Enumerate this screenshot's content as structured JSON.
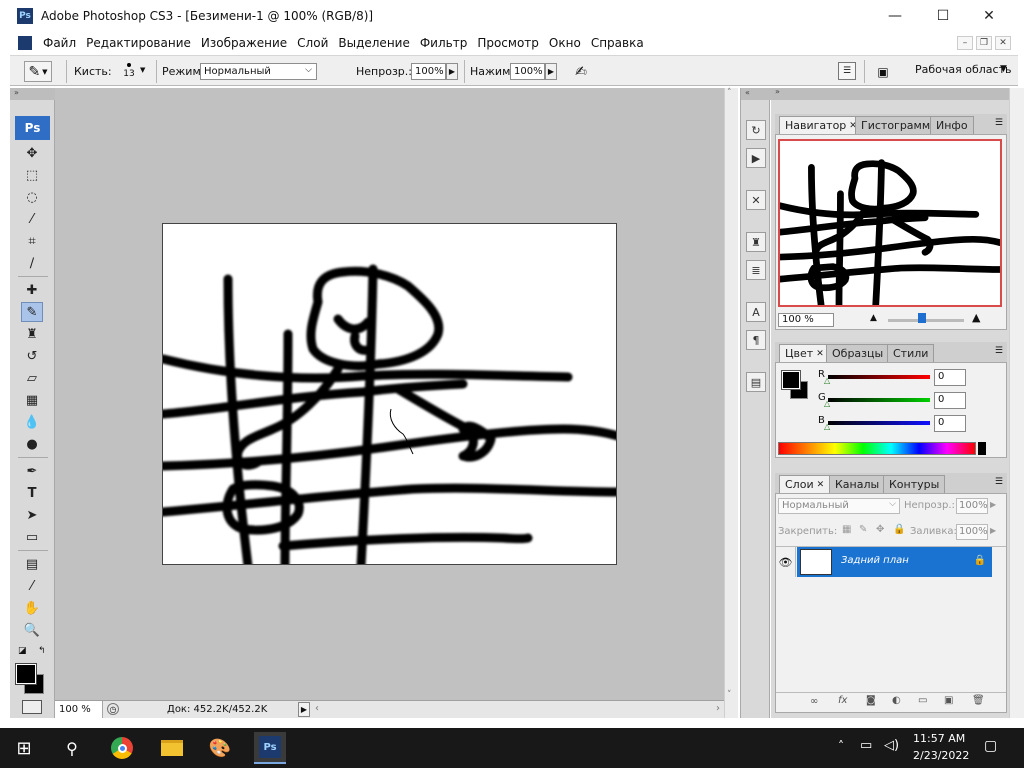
{
  "window": {
    "app_icon": "Ps",
    "title": "Adobe Photoshop CS3 - [Безимени-1 @ 100% (RGB/8)]",
    "minimize": "—",
    "maximize": "☐",
    "close": "✕"
  },
  "menu": [
    "Файл",
    "Редактирование",
    "Изображение",
    "Слой",
    "Выделение",
    "Фильтр",
    "Просмотр",
    "Окно",
    "Справка"
  ],
  "options": {
    "brush_label": "Кисть:",
    "brush_size": "13",
    "mode_label": "Режим:",
    "mode_value": "Нормальный",
    "opacity_label": "Непрозр.:",
    "opacity_value": "100%",
    "flow_label": "Нажим:",
    "flow_value": "100%",
    "workspace_label": "Рабочая область"
  },
  "toolbar": {
    "logo": "Ps"
  },
  "status": {
    "zoom": "100 %",
    "doc_info": "Док: 452.2K/452.2K"
  },
  "navigator": {
    "tabs": [
      "Навигатор",
      "Гистограмма",
      "Инфо"
    ],
    "zoom": "100 %"
  },
  "color_panel": {
    "tabs": [
      "Цвет",
      "Образцы",
      "Стили"
    ],
    "channels": [
      {
        "label": "R",
        "value": "0"
      },
      {
        "label": "G",
        "value": "0"
      },
      {
        "label": "B",
        "value": "0"
      }
    ]
  },
  "layers_panel": {
    "tabs": [
      "Слои",
      "Каналы",
      "Контуры"
    ],
    "blend_mode": "Нормальный",
    "opacity_label": "Непрозр.:",
    "opacity_value": "100%",
    "lock_label": "Закрепить:",
    "fill_label": "Заливка:",
    "fill_value": "100%",
    "layer_name": "Задний план"
  },
  "taskbar": {
    "time": "11:57 AM",
    "date": "2/23/2022",
    "ps_label": "Ps"
  },
  "colors": {
    "selection_blue": "#1a73d1",
    "workspace_gray": "#c1c1c1",
    "taskbar": "#181818"
  }
}
